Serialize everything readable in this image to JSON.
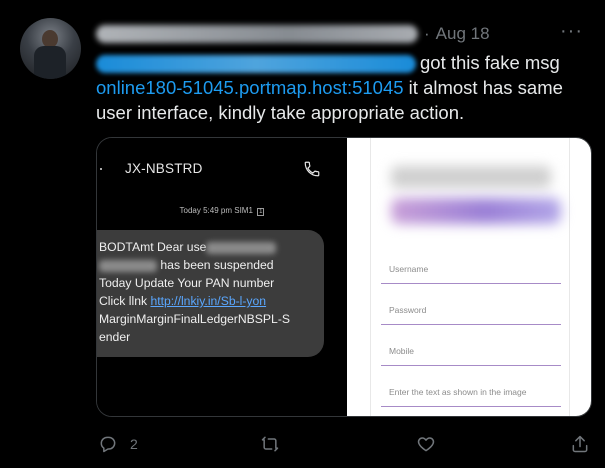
{
  "tweet": {
    "author_blurred": true,
    "separator": "·",
    "date": "Aug 18",
    "more_icon": "more-icon",
    "text_part1": "got this fake msg",
    "link": "online180-51045.portmap.host:51045",
    "text_part2": " it  almost  has same user interface,  kindly take appropriate action."
  },
  "sms": {
    "sender": "JX-NBSTRD",
    "timestamp": "Today 5:49 pm",
    "sim": "SIM1",
    "line1": "BODTAmt Dear use",
    "line2": " has been suspended",
    "line3": "Today Update Your PAN  number",
    "line4_prefix": "Click  llnk ",
    "line4_link": "http://lnkiy.in/Sb-l-yon",
    "line5": "MarginMarginFinalLedgerNBSPL-S",
    "line6": "ender"
  },
  "form": {
    "fields": [
      {
        "placeholder": "Username"
      },
      {
        "placeholder": "Password"
      },
      {
        "placeholder": "Mobile"
      },
      {
        "placeholder": "Enter the text as shown in the image"
      }
    ],
    "accent": "#a78bc7"
  },
  "actions": {
    "reply_count": "2",
    "retweet_count": "",
    "like_count": ""
  },
  "colors": {
    "background": "#000000",
    "text": "#e7e9ea",
    "muted": "#71767b",
    "link": "#1d9bf0"
  }
}
